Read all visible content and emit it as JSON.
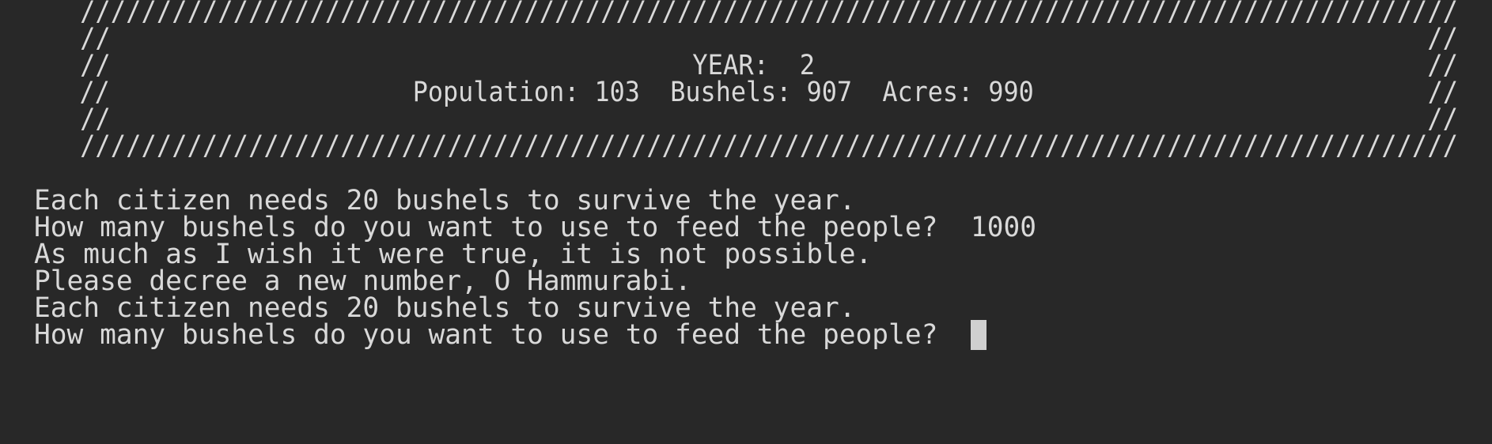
{
  "banner": {
    "border_line": "   //////////////////////////////////////////////////////////////////////////////////////////",
    "edge_line": "   //                                                                                      //",
    "year_line": "   //                                      YEAR:  2                                        //",
    "stats_line": "   //                    Population: 103  Bushels: 907  Acres: 990                          //",
    "year_label": "YEAR:",
    "year_value": "2",
    "population_label": "Population:",
    "population_value": "103",
    "bushels_label": "Bushels:",
    "bushels_value": "907",
    "acres_label": "Acres:",
    "acres_value": "990"
  },
  "output": {
    "line1": "Each citizen needs 20 bushels to survive the year.",
    "line2": "How many bushels do you want to use to feed the people?  1000",
    "line3": "As much as I wish it were true, it is not possible.",
    "line4": "Please decree a new number, O Hammurabi.",
    "line5": "Each citizen needs 20 bushels to survive the year.",
    "prompt": "How many bushels do you want to use to feed the people?  "
  },
  "colors": {
    "background": "#282828",
    "text": "#d9d9d9",
    "cursor": "#d0d0d0"
  }
}
